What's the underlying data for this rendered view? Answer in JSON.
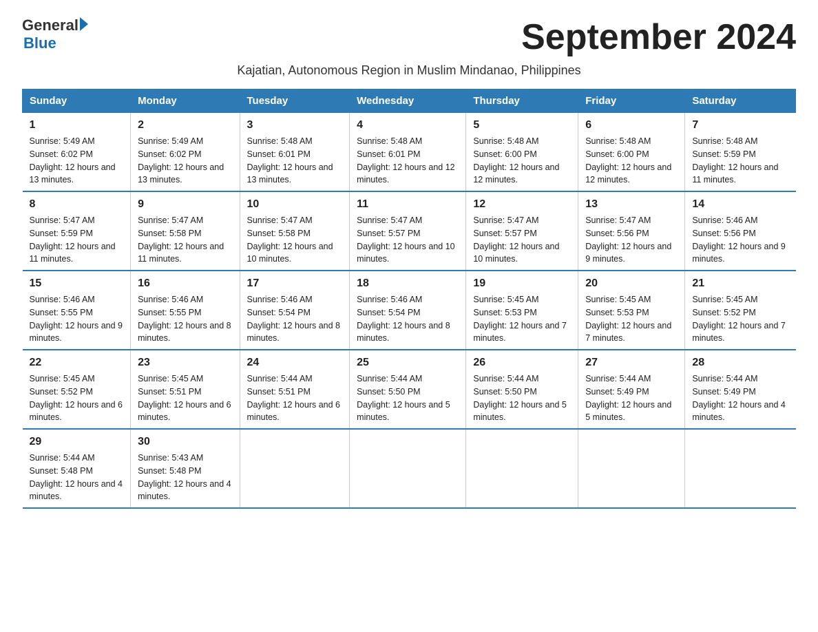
{
  "logo": {
    "text_general": "General",
    "triangle": "▶",
    "text_blue": "Blue"
  },
  "title": "September 2024",
  "subtitle": "Kajatian, Autonomous Region in Muslim Mindanao, Philippines",
  "days_of_week": [
    "Sunday",
    "Monday",
    "Tuesday",
    "Wednesday",
    "Thursday",
    "Friday",
    "Saturday"
  ],
  "weeks": [
    [
      {
        "day": "1",
        "sunrise": "5:49 AM",
        "sunset": "6:02 PM",
        "daylight": "12 hours and 13 minutes."
      },
      {
        "day": "2",
        "sunrise": "5:49 AM",
        "sunset": "6:02 PM",
        "daylight": "12 hours and 13 minutes."
      },
      {
        "day": "3",
        "sunrise": "5:48 AM",
        "sunset": "6:01 PM",
        "daylight": "12 hours and 13 minutes."
      },
      {
        "day": "4",
        "sunrise": "5:48 AM",
        "sunset": "6:01 PM",
        "daylight": "12 hours and 12 minutes."
      },
      {
        "day": "5",
        "sunrise": "5:48 AM",
        "sunset": "6:00 PM",
        "daylight": "12 hours and 12 minutes."
      },
      {
        "day": "6",
        "sunrise": "5:48 AM",
        "sunset": "6:00 PM",
        "daylight": "12 hours and 12 minutes."
      },
      {
        "day": "7",
        "sunrise": "5:48 AM",
        "sunset": "5:59 PM",
        "daylight": "12 hours and 11 minutes."
      }
    ],
    [
      {
        "day": "8",
        "sunrise": "5:47 AM",
        "sunset": "5:59 PM",
        "daylight": "12 hours and 11 minutes."
      },
      {
        "day": "9",
        "sunrise": "5:47 AM",
        "sunset": "5:58 PM",
        "daylight": "12 hours and 11 minutes."
      },
      {
        "day": "10",
        "sunrise": "5:47 AM",
        "sunset": "5:58 PM",
        "daylight": "12 hours and 10 minutes."
      },
      {
        "day": "11",
        "sunrise": "5:47 AM",
        "sunset": "5:57 PM",
        "daylight": "12 hours and 10 minutes."
      },
      {
        "day": "12",
        "sunrise": "5:47 AM",
        "sunset": "5:57 PM",
        "daylight": "12 hours and 10 minutes."
      },
      {
        "day": "13",
        "sunrise": "5:47 AM",
        "sunset": "5:56 PM",
        "daylight": "12 hours and 9 minutes."
      },
      {
        "day": "14",
        "sunrise": "5:46 AM",
        "sunset": "5:56 PM",
        "daylight": "12 hours and 9 minutes."
      }
    ],
    [
      {
        "day": "15",
        "sunrise": "5:46 AM",
        "sunset": "5:55 PM",
        "daylight": "12 hours and 9 minutes."
      },
      {
        "day": "16",
        "sunrise": "5:46 AM",
        "sunset": "5:55 PM",
        "daylight": "12 hours and 8 minutes."
      },
      {
        "day": "17",
        "sunrise": "5:46 AM",
        "sunset": "5:54 PM",
        "daylight": "12 hours and 8 minutes."
      },
      {
        "day": "18",
        "sunrise": "5:46 AM",
        "sunset": "5:54 PM",
        "daylight": "12 hours and 8 minutes."
      },
      {
        "day": "19",
        "sunrise": "5:45 AM",
        "sunset": "5:53 PM",
        "daylight": "12 hours and 7 minutes."
      },
      {
        "day": "20",
        "sunrise": "5:45 AM",
        "sunset": "5:53 PM",
        "daylight": "12 hours and 7 minutes."
      },
      {
        "day": "21",
        "sunrise": "5:45 AM",
        "sunset": "5:52 PM",
        "daylight": "12 hours and 7 minutes."
      }
    ],
    [
      {
        "day": "22",
        "sunrise": "5:45 AM",
        "sunset": "5:52 PM",
        "daylight": "12 hours and 6 minutes."
      },
      {
        "day": "23",
        "sunrise": "5:45 AM",
        "sunset": "5:51 PM",
        "daylight": "12 hours and 6 minutes."
      },
      {
        "day": "24",
        "sunrise": "5:44 AM",
        "sunset": "5:51 PM",
        "daylight": "12 hours and 6 minutes."
      },
      {
        "day": "25",
        "sunrise": "5:44 AM",
        "sunset": "5:50 PM",
        "daylight": "12 hours and 5 minutes."
      },
      {
        "day": "26",
        "sunrise": "5:44 AM",
        "sunset": "5:50 PM",
        "daylight": "12 hours and 5 minutes."
      },
      {
        "day": "27",
        "sunrise": "5:44 AM",
        "sunset": "5:49 PM",
        "daylight": "12 hours and 5 minutes."
      },
      {
        "day": "28",
        "sunrise": "5:44 AM",
        "sunset": "5:49 PM",
        "daylight": "12 hours and 4 minutes."
      }
    ],
    [
      {
        "day": "29",
        "sunrise": "5:44 AM",
        "sunset": "5:48 PM",
        "daylight": "12 hours and 4 minutes."
      },
      {
        "day": "30",
        "sunrise": "5:43 AM",
        "sunset": "5:48 PM",
        "daylight": "12 hours and 4 minutes."
      },
      null,
      null,
      null,
      null,
      null
    ]
  ]
}
